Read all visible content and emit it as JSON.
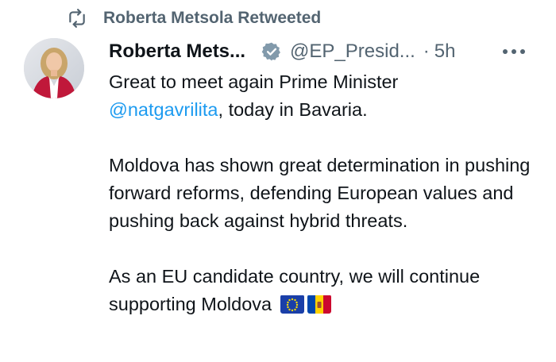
{
  "retweet": {
    "icon": "retweet-icon",
    "label": "Roberta Metsola Retweeted"
  },
  "tweet": {
    "avatar_icon": "profile-photo",
    "author_name": "Roberta Mets...",
    "verified_icon": "verified-badge-icon",
    "handle": "@EP_Presid...",
    "separator": "·",
    "time": "5h",
    "more_icon": "more-options-icon",
    "line1": "Great to meet again Prime Minister",
    "mention": "@natgavrilita",
    "line2_rest": ", today in Bavaria.",
    "para2": "Moldova has shown great determination in pushing forward reforms, defending European values and pushing back against hybrid threats.",
    "para3": "As an EU candidate country, we will continue supporting Moldova",
    "flags": [
      "eu-flag-icon",
      "moldova-flag-icon"
    ]
  },
  "colors": {
    "secondary_text": "#536471",
    "link": "#1d9bf0",
    "verified_badge": "#829aab"
  }
}
